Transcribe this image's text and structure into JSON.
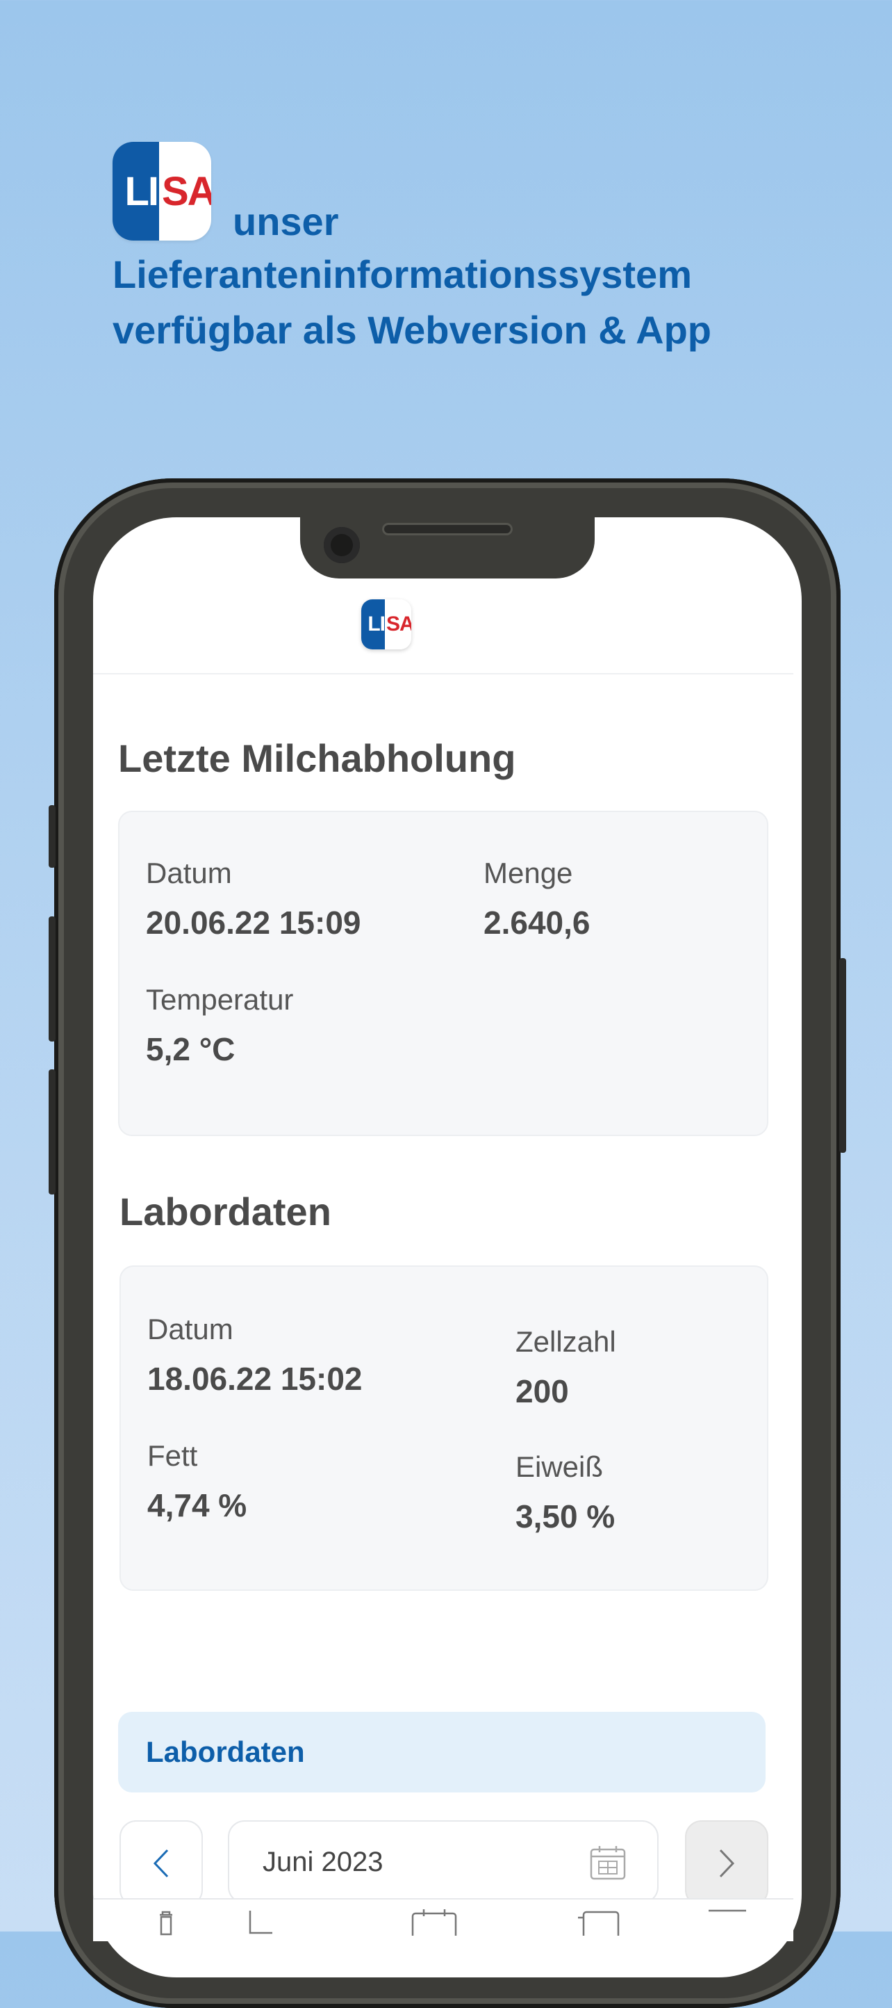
{
  "hero": {
    "logo_left": "LI",
    "logo_right": "SA",
    "line1": "unser",
    "line2": "Lieferanteninformationssystem",
    "line3": "verfügbar als Webversion & App"
  },
  "app": {
    "logo_left": "LI",
    "logo_right": "SA",
    "milk": {
      "title": "Letzte Milchabholung",
      "date_label": "Datum",
      "date_value": "20.06.22 15:09",
      "amount_label": "Menge",
      "amount_value": "2.640,6",
      "temp_label": "Temperatur",
      "temp_value": "5,2 °C"
    },
    "lab": {
      "title": "Labordaten",
      "date_label": "Datum",
      "date_value": "18.06.22 15:02",
      "cells_label": "Zellzahl",
      "cells_value": "200",
      "fat_label": "Fett",
      "fat_value": "4,74 %",
      "protein_label": "Eiweiß",
      "protein_value": "3,50 %"
    },
    "banner": "Labordaten",
    "month_picker": {
      "value": "Juni 2023"
    }
  },
  "icons": [
    "chevron-left-icon",
    "chevron-right-icon",
    "calendar-icon",
    "trash-icon",
    "chart-icon",
    "calendar-tab-icon",
    "document-icon",
    "menu-icon"
  ],
  "colors": {
    "brand_blue": "#0d5ea9",
    "brand_red": "#d8262c",
    "background": "#9cc6ec"
  }
}
